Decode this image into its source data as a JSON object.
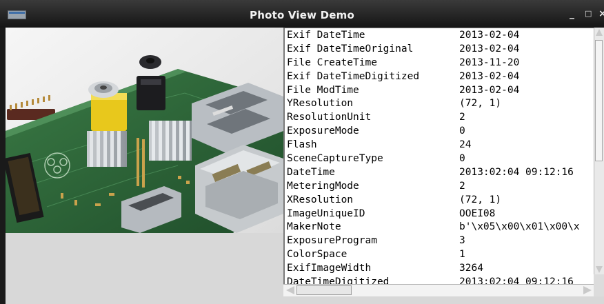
{
  "window": {
    "title": "Photo View Demo",
    "buttons": {
      "minimize": "_",
      "maximize": "□",
      "close": "×"
    }
  },
  "photo": {
    "icon": "image-icon",
    "alt": "Raspberry Pi board"
  },
  "exif": {
    "rows": [
      {
        "key": "Exif DateTime",
        "value": "2013-02-04"
      },
      {
        "key": "Exif DateTimeOriginal",
        "value": "2013-02-04"
      },
      {
        "key": "File CreateTime",
        "value": "2013-11-20"
      },
      {
        "key": "Exif DateTimeDigitized",
        "value": "2013-02-04"
      },
      {
        "key": "File ModTime",
        "value": "2013-02-04"
      },
      {
        "key": "YResolution",
        "value": "(72, 1)"
      },
      {
        "key": "ResolutionUnit",
        "value": "2"
      },
      {
        "key": "ExposureMode",
        "value": "0"
      },
      {
        "key": "Flash",
        "value": "24"
      },
      {
        "key": "SceneCaptureType",
        "value": "0"
      },
      {
        "key": "DateTime",
        "value": "2013:02:04 09:12:16"
      },
      {
        "key": "MeteringMode",
        "value": "2"
      },
      {
        "key": "XResolution",
        "value": "(72, 1)"
      },
      {
        "key": "ImageUniqueID",
        "value": "OOEI08"
      },
      {
        "key": "MakerNote",
        "value": "b'\\x05\\x00\\x01\\x00\\x"
      },
      {
        "key": "ExposureProgram",
        "value": "3"
      },
      {
        "key": "ColorSpace",
        "value": "1"
      },
      {
        "key": "ExifImageWidth",
        "value": "3264"
      },
      {
        "key": "DateTimeDigitized",
        "value": "2013:02:04 09:12:16"
      }
    ]
  },
  "colors": {
    "titlebar": "#222222",
    "client": "#d8d8d8",
    "panel": "#ffffff",
    "pcb": "#2f6b3a",
    "connector_yellow": "#e8c81c"
  }
}
